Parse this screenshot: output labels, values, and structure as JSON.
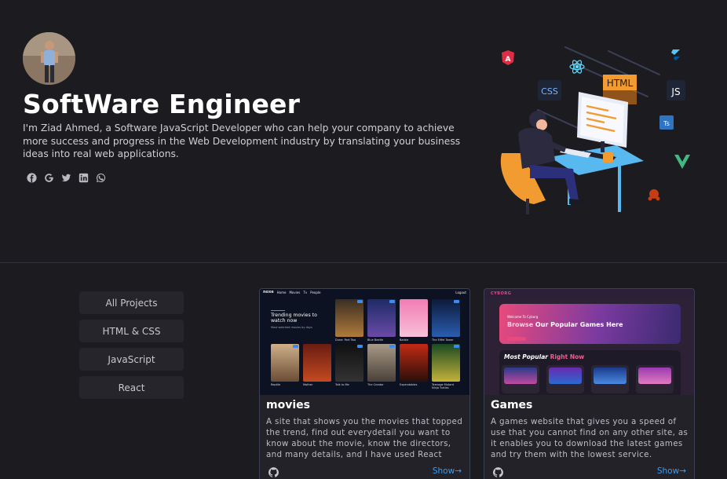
{
  "hero": {
    "title": "SoftWare Engineer",
    "description": "I'm Ziad Ahmed, a Software JavaScript Developer who can help your company to achieve more success and progress in the Web Development industry by translating your business ideas into real web applications.",
    "socials": [
      "facebook-icon",
      "google-icon",
      "twitter-icon",
      "linkedin-icon",
      "whatsapp-icon"
    ]
  },
  "illustration": {
    "badges": {
      "html": "HTML",
      "css": "CSS",
      "js": "JS",
      "ts": "Ts"
    }
  },
  "filters": [
    "All Projects",
    "HTML & CSS",
    "JavaScript",
    "React"
  ],
  "projects": [
    {
      "title": "movies",
      "description": "A site that shows you the movies that topped the trend, find out everydetail you want to know about the movie, know the directors, and many details, and I have used React",
      "show_label": "Show→",
      "preview": {
        "brand": "noxe",
        "nav": [
          "Home",
          "Movies",
          "Tv",
          "People"
        ],
        "logout": "Logout",
        "heading": "Trending movies to watch now",
        "sub": "Most watched movies by days",
        "posters": [
          "Dune: Part Two",
          "Blue Beetle",
          "Barbie",
          "The Eiffel Tower",
          "Reptile",
          "Mother",
          "Talk to Me",
          "The Creator",
          "Expendables",
          "Teenage Mutant Ninja Turtles"
        ]
      }
    },
    {
      "title": "Games",
      "description": "A games website that gives you a speed of use that you cannot find on any other site, as it enables you to download the latest games and try them with the lowest service.",
      "show_label": "Show→",
      "preview": {
        "brand": "CYBORG",
        "welcome": "Welcome To Cyborg",
        "heading_accent": "Browse",
        "heading_rest": " Our Popular Games Here",
        "popular": "Most Popular",
        "popular_accent": " Right Now"
      }
    }
  ],
  "colors": {
    "background": "#1c1b20",
    "accent_link": "#3b9cf0",
    "games_pink": "#e94a7c"
  }
}
